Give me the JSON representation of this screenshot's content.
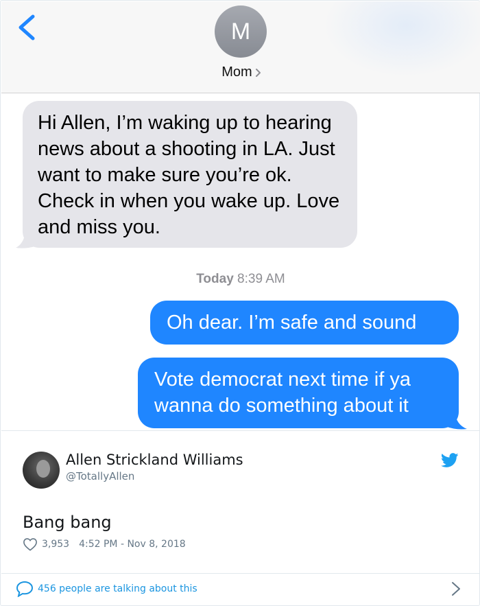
{
  "conversation": {
    "contact_initial": "M",
    "contact_name": "Mom",
    "incoming_message": "Hi Allen, I’m waking up to hearing news about a shooting in LA. Just want to make sure you’re ok. Check in when you wake up. Love and miss you.",
    "timestamp_day": "Today",
    "timestamp_time": "8:39 AM",
    "outgoing_messages": [
      "Oh dear. I’m safe and sound",
      "Vote democrat next time if ya wanna do something about it"
    ]
  },
  "tweet": {
    "author_name": "Allen Strickland Williams",
    "author_handle": "@TotallyAllen",
    "text": "Bang bang",
    "likes": "3,953",
    "posted_at": "4:52 PM - Nov 8, 2018",
    "talking_about": "456 people are talking about this"
  },
  "colors": {
    "ios_blue": "#1f86ff",
    "incoming_gray": "#e5e5ea",
    "twitter_blue": "#1da1f2",
    "link_blue": "#1b95e0"
  },
  "icons": [
    "back-chevron-icon",
    "chevron-right-icon",
    "twitter-bird-icon",
    "heart-icon",
    "speech-bubble-icon",
    "chevron-right-icon"
  ]
}
